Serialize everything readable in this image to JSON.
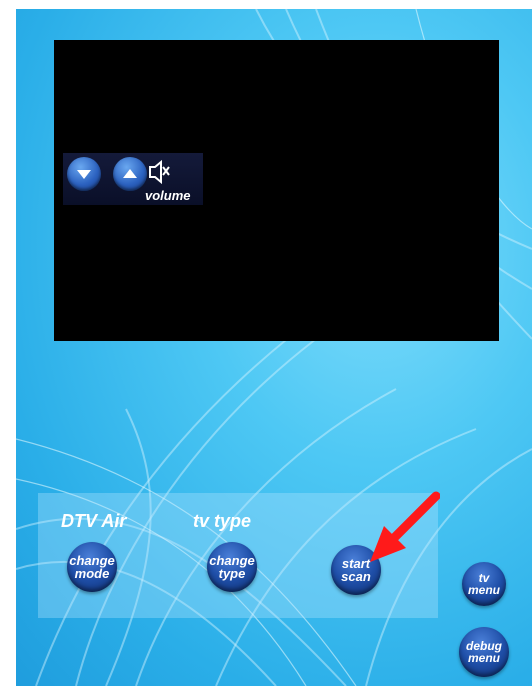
{
  "volume": {
    "label": "volume",
    "down_icon": "chevron-down-icon",
    "up_icon": "chevron-up-icon",
    "mute_icon": "speaker-mute-icon"
  },
  "panel": {
    "mode_heading": "DTV Air",
    "type_heading": "tv type"
  },
  "buttons": {
    "change_mode": [
      "change",
      "mode"
    ],
    "change_type": [
      "change",
      "type"
    ],
    "start_scan": [
      "start",
      "scan"
    ],
    "tv_menu": [
      "tv",
      "menu"
    ],
    "debug_menu": [
      "debug",
      "menu"
    ]
  },
  "colors": {
    "background": "#2aaee8",
    "button": "#1f4fa8",
    "annotation_arrow": "#ff1a1a"
  }
}
